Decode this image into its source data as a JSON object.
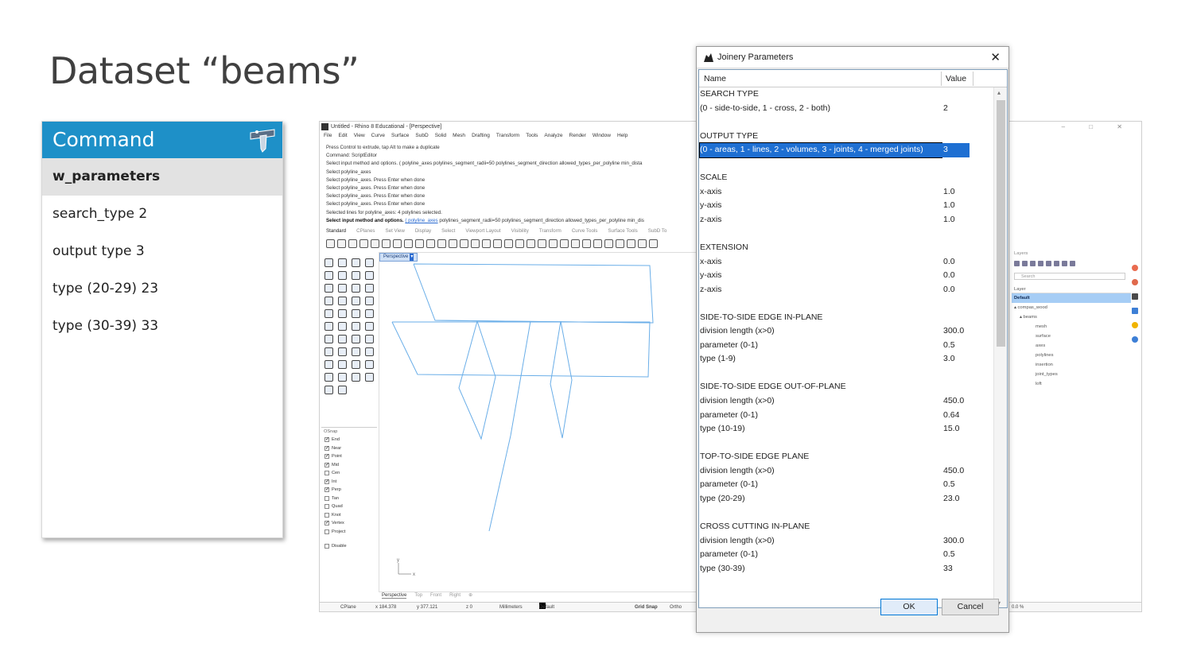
{
  "slide": {
    "title": "Dataset “beams”"
  },
  "command_panel": {
    "header": "Command",
    "rows": [
      "w_parameters",
      "search_type 2",
      "output type 3",
      "type (20-29) 23",
      "type (30-39) 33"
    ]
  },
  "rhino": {
    "title": "Untitled - Rhino 8 Educational - [Perspective]",
    "menu": [
      "File",
      "Edit",
      "View",
      "Curve",
      "Surface",
      "SubD",
      "Solid",
      "Mesh",
      "Drafting",
      "Transform",
      "Tools",
      "Analyze",
      "Render",
      "Window",
      "Help"
    ],
    "history": [
      "Press Control to extrude, tap Alt to make a duplicate",
      "Command: ScriptEditor",
      "Select input method and options. ( polyline_axes  polylines_segment_radii=50  polylines_segment_direction  allowed_types_per_polyline  min_dista",
      "Select polyline_axes",
      "Select polyline_axes. Press Enter when done",
      "Select polyline_axes. Press Enter when done",
      "Select polyline_axes. Press Enter when done",
      "Select polyline_axes. Press Enter when done",
      "Selected lines for polyline_axes: 4 polylines selected."
    ],
    "prompt_bold": "Select input method and options.",
    "prompt_link": "( polyline_axes",
    "prompt_rest": " polylines_segment_radii=50  polylines_segment_direction  allowed_types_per_polyline  min_dis",
    "tabs": [
      "Standard",
      "CPlanes",
      "Set View",
      "Display",
      "Select",
      "Viewport Layout",
      "Visibility",
      "Transform",
      "Curve Tools",
      "Surface Tools",
      "SubD To"
    ],
    "viewport_label": "Perspective",
    "viewport_tabs": [
      "Perspective",
      "Top",
      "Front",
      "Right",
      "⊕"
    ],
    "osnap": {
      "title": "OSnap",
      "items": [
        {
          "label": "End",
          "checked": true
        },
        {
          "label": "Near",
          "checked": true
        },
        {
          "label": "Point",
          "checked": true
        },
        {
          "label": "Mid",
          "checked": true
        },
        {
          "label": "Cen",
          "checked": false
        },
        {
          "label": "Int",
          "checked": true
        },
        {
          "label": "Perp",
          "checked": true
        },
        {
          "label": "Tan",
          "checked": false
        },
        {
          "label": "Quad",
          "checked": false
        },
        {
          "label": "Knot",
          "checked": false
        },
        {
          "label": "Vertex",
          "checked": true
        },
        {
          "label": "Project",
          "checked": false
        },
        {
          "label": "Disable",
          "checked": false
        }
      ]
    },
    "status": {
      "cplane": "CPlane",
      "x": "x 184.378",
      "y": "y 377.121",
      "z": "z 0",
      "units": "Millimeters",
      "layer": "Default",
      "grid_snap": "Grid Snap",
      "ortho": "Ortho",
      "percent": "0.0 %"
    },
    "layers": {
      "title": "Layers",
      "search": "Search",
      "header": "Layer",
      "items": [
        "Default",
        "▴ compas_wood",
        "▴ beams",
        "mesh",
        "surface",
        "axes",
        "polylines",
        "insertion",
        "joint_types",
        "loft"
      ]
    }
  },
  "dialog": {
    "title": "Joinery Parameters",
    "col_name": "Name",
    "col_value": "Value",
    "rows": [
      {
        "name": "SEARCH TYPE",
        "value": ""
      },
      {
        "name": "(0 - side-to-side, 1 - cross, 2 - both)",
        "value": "2"
      },
      {
        "name": "",
        "value": ""
      },
      {
        "name": "OUTPUT TYPE",
        "value": ""
      },
      {
        "name": "(0 - areas, 1 - lines, 2 - volumes, 3 - joints, 4 - merged joints)",
        "value": "3"
      },
      {
        "name": "",
        "value": ""
      },
      {
        "name": "SCALE",
        "value": ""
      },
      {
        "name": "x-axis",
        "value": "1.0"
      },
      {
        "name": "y-axis",
        "value": "1.0"
      },
      {
        "name": "z-axis",
        "value": "1.0"
      },
      {
        "name": "",
        "value": ""
      },
      {
        "name": "EXTENSION",
        "value": ""
      },
      {
        "name": "x-axis",
        "value": "0.0"
      },
      {
        "name": "y-axis",
        "value": "0.0"
      },
      {
        "name": "z-axis",
        "value": "0.0"
      },
      {
        "name": "",
        "value": ""
      },
      {
        "name": "SIDE-TO-SIDE EDGE IN-PLANE",
        "value": ""
      },
      {
        "name": "division length (x>0)",
        "value": "300.0"
      },
      {
        "name": "parameter (0-1)",
        "value": "0.5"
      },
      {
        "name": "type (1-9)",
        "value": "3.0"
      },
      {
        "name": "",
        "value": ""
      },
      {
        "name": "SIDE-TO-SIDE EDGE OUT-OF-PLANE",
        "value": ""
      },
      {
        "name": "division length (x>0)",
        "value": "450.0"
      },
      {
        "name": "parameter (0-1)",
        "value": "0.64"
      },
      {
        "name": "type (10-19)",
        "value": "15.0"
      },
      {
        "name": "",
        "value": ""
      },
      {
        "name": "TOP-TO-SIDE EDGE PLANE",
        "value": ""
      },
      {
        "name": "division length (x>0)",
        "value": "450.0"
      },
      {
        "name": "parameter (0-1)",
        "value": "0.5"
      },
      {
        "name": "type (20-29)",
        "value": "23.0"
      },
      {
        "name": "",
        "value": ""
      },
      {
        "name": "CROSS CUTTING IN-PLANE",
        "value": ""
      },
      {
        "name": "division length (x>0)",
        "value": "300.0"
      },
      {
        "name": "parameter (0-1)",
        "value": "0.5"
      },
      {
        "name": "type (30-39)",
        "value": "33"
      }
    ],
    "selected_row": 4,
    "ok_label": "OK",
    "cancel_label": "Cancel"
  },
  "colors": {
    "accent": "#1e90c8",
    "selection": "#1e6fd2",
    "curves": "#6aaee8"
  }
}
